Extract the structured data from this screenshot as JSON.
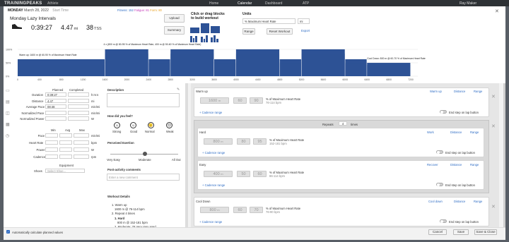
{
  "topbar": {
    "logo": "TRAININGPEAKS",
    "athlete": "Athlete",
    "nav": [
      "Home",
      "Calendar",
      "Dashboard",
      "ATP"
    ],
    "user": "Ray Maker"
  },
  "workout": {
    "day": "MONDAY",
    "date": "March 28, 2022",
    "time_label": "Start Time",
    "title": "Monday Lazy Intervals",
    "duration": "0:39:27",
    "distance": "4.47",
    "distance_unit": "mi",
    "tss": "38",
    "tss_unit": "TSS",
    "legend": [
      "Fitness: 152",
      "Fatigue: 81",
      "Form: 80"
    ]
  },
  "builder": {
    "upload_label": "Upload",
    "summary_label": "Summary",
    "blocks_title": "Click or drag blocks",
    "blocks_sub": "to build workout",
    "units_title": "Units",
    "unit_select": "% Maximum Heart Rate",
    "unit_select2": "mi",
    "range_label": "Range",
    "reset_label": "Reset Workout",
    "export_label": "Export"
  },
  "chart_data": {
    "type": "bar",
    "title": "",
    "xlabel": "",
    "ylabel": "",
    "y_ticks": [
      "100%",
      "50%",
      "0%"
    ],
    "x_ticks": [
      "0",
      "400",
      "800",
      "1200",
      "1600",
      "2000",
      "2400",
      "2800",
      "3200",
      "3600",
      "4000",
      "4400",
      "4800",
      "5200",
      "5600",
      "6000",
      "6400",
      "6800",
      "7200"
    ],
    "segments": [
      {
        "start": 0,
        "end": 1600,
        "low": 76,
        "high": 114
      },
      {
        "start": 1600,
        "end": 2400,
        "low": 152,
        "high": 181
      },
      {
        "start": 2400,
        "end": 2800,
        "low": 86,
        "high": 114
      },
      {
        "start": 2800,
        "end": 3600,
        "low": 152,
        "high": 181
      },
      {
        "start": 3600,
        "end": 4000,
        "low": 86,
        "high": 114
      },
      {
        "start": 4000,
        "end": 4800,
        "low": 152,
        "high": 181
      },
      {
        "start": 4800,
        "end": 5200,
        "low": 86,
        "high": 114
      },
      {
        "start": 5200,
        "end": 6000,
        "low": 152,
        "high": 181
      },
      {
        "start": 6000,
        "end": 6400,
        "low": 86,
        "high": 114
      },
      {
        "start": 6400,
        "end": 7200,
        "low": 76,
        "high": 90
      }
    ],
    "annotations": [
      "Warm up: 1600 m @ 60-90 % of Maximum Heart Rate",
      "4 x (800 m @ 80-95 % of Maximum Heart Rate, 400 m @ 50-60 % of Maximum Heart Rate)",
      "Cool Down: 800 m @ 60-70 % of Maximum Heart Rate"
    ]
  },
  "summary": {
    "planned_label": "Planned",
    "completed_label": "Completed",
    "rows": [
      {
        "label": "Duration",
        "planned": "0:39:27",
        "unit": "h:m:s"
      },
      {
        "label": "Distance",
        "planned": "4.47",
        "unit": "mi"
      },
      {
        "label": "Average Pace",
        "planned": "08:48",
        "unit": "min/mi"
      },
      {
        "label": "Normalized Pace",
        "planned": "",
        "unit": "min/mi"
      },
      {
        "label": "Normalized Power",
        "planned": "",
        "unit": "W"
      }
    ],
    "min_label": "Min",
    "avg_label": "Avg",
    "max_label": "Max",
    "mam_rows": [
      {
        "label": "Pace",
        "unit": "min/mi"
      },
      {
        "label": "Heart Rate",
        "unit": "bpm"
      },
      {
        "label": "Power",
        "unit": "W"
      },
      {
        "label": "Cadence",
        "unit": "rpm"
      }
    ],
    "equipment_label": "Equipment",
    "shoes_label": "Shoes",
    "shoes_value": "Select Shoe..."
  },
  "description": {
    "label": "Description",
    "feel_label": "How did you feel?",
    "feel_options": [
      "Strong",
      "Good",
      "Normal",
      "Weak"
    ],
    "exertion_label": "Perceived Exertion",
    "exertion_scale": [
      "Very Easy",
      "Moderate",
      "All Out"
    ],
    "comments_label": "Post-activity comments",
    "comments_placeholder": "Enter a new comment",
    "details_label": "Workout Details",
    "details": [
      "1. Warm up",
      "1600 m @ 76-114 bpm",
      "2. Repeat 4 times",
      "1. Hard",
      "800 m @ 152-181 bpm",
      "2. Moderate: 78 Very Very Hard"
    ]
  },
  "steps": {
    "warmup": {
      "title": "Warm up",
      "type": "Warm up",
      "distance": "1600",
      "unit": "m",
      "low": "60",
      "high": "90",
      "pct": "% of Maximum Heart Rate",
      "bpm": "76-114 bpm"
    },
    "repeat_label": "Repeats",
    "repeat_count": "4",
    "repeat_times": "times",
    "hard": {
      "title": "Hard",
      "type": "Work",
      "distance": "800",
      "unit": "m",
      "low": "80",
      "high": "95",
      "pct": "% of Maximum Heart Rate",
      "bpm": "152-181 bpm"
    },
    "easy": {
      "title": "Easy",
      "type": "Recover",
      "distance": "400",
      "unit": "m",
      "low": "50",
      "high": "60",
      "pct": "% of Maximum Heart Rate",
      "bpm": "86-114 bpm"
    },
    "cooldown": {
      "title": "Cool Down",
      "type": "Cool down",
      "distance": "800",
      "unit": "m",
      "low": "60",
      "high": "70",
      "pct": "% of Maximum Heart Rate",
      "bpm": "76-90 bpm"
    },
    "distance_label": "Distance",
    "range_label": "Range",
    "cadence_label": "Cadence range",
    "lap_label": "End step on lap button"
  },
  "footer": {
    "auto_calc": "Automatically calculate planned values",
    "cancel": "Cancel",
    "save": "Save",
    "save_close": "Save & Close"
  }
}
